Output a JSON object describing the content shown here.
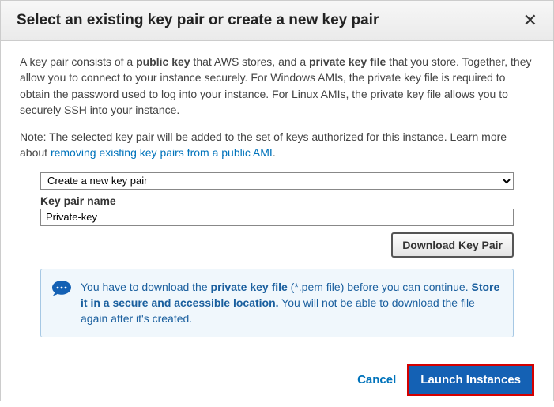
{
  "header": {
    "title": "Select an existing key pair or create a new key pair"
  },
  "description": {
    "part1": "A key pair consists of a ",
    "bold1": "public key",
    "part2": " that AWS stores, and a ",
    "bold2": "private key file",
    "part3": " that you store. Together, they allow you to connect to your instance securely. For Windows AMIs, the private key file is required to obtain the password used to log into your instance. For Linux AMIs, the private key file allows you to securely SSH into your instance."
  },
  "note": {
    "prefix": "Note: The selected key pair will be added to the set of keys authorized for this instance. Learn more about ",
    "link": "removing existing key pairs from a public AMI",
    "suffix": "."
  },
  "form": {
    "select_value": "Create a new key pair",
    "name_label": "Key pair name",
    "name_value": "Private-key",
    "download_label": "Download Key Pair"
  },
  "info": {
    "part1": "You have to download the ",
    "bold1": "private key file",
    "part2": " (*.pem file) before you can continue. ",
    "bold2": "Store it in a secure and accessible location.",
    "part3": " You will not be able to download the file again after it's created."
  },
  "footer": {
    "cancel": "Cancel",
    "launch": "Launch Instances"
  }
}
